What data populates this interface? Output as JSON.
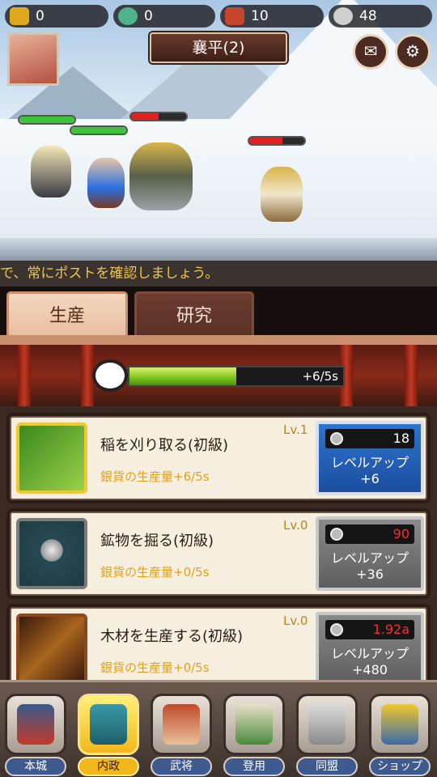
{
  "resources": {
    "gold": "0",
    "gem": "0",
    "ticket": "10",
    "silver": "48"
  },
  "location_title": "襄平(2)",
  "ticker_text": "で、常にポストを確認しましょう。",
  "tabs": [
    {
      "label": "生産",
      "active": true
    },
    {
      "label": "研究",
      "active": false
    }
  ],
  "production": {
    "rate_text": "+6/5s",
    "progress": 0.5
  },
  "tasks": [
    {
      "name": "稲を刈り取る(初級)",
      "level": "Lv.1",
      "desc": "銀貨の生産量+6/5s",
      "cost": "18",
      "upgrade_label": "レベルアップ",
      "gain": "+6",
      "available": true
    },
    {
      "name": "鉱物を掘る(初級)",
      "level": "Lv.0",
      "desc": "銀貨の生産量+0/5s",
      "cost": "90",
      "upgrade_label": "レベルアップ",
      "gain": "+36",
      "available": false
    },
    {
      "name": "木材を生産する(初級)",
      "level": "Lv.0",
      "desc": "銀貨の生産量+0/5s",
      "cost": "1.92a",
      "upgrade_label": "レベルアップ",
      "gain": "+480",
      "available": false
    }
  ],
  "nav": [
    {
      "label": "本城",
      "selected": false
    },
    {
      "label": "内政",
      "selected": true
    },
    {
      "label": "武将",
      "selected": false
    },
    {
      "label": "登用",
      "selected": false
    },
    {
      "label": "同盟",
      "selected": false
    },
    {
      "label": "ショップ",
      "selected": false
    }
  ],
  "colors": {
    "accent": "#f2b71a",
    "progress": "#7ac21c",
    "cost_unaffordable": "#ff2a2a",
    "upgrade_available": "#1f5fb8"
  }
}
